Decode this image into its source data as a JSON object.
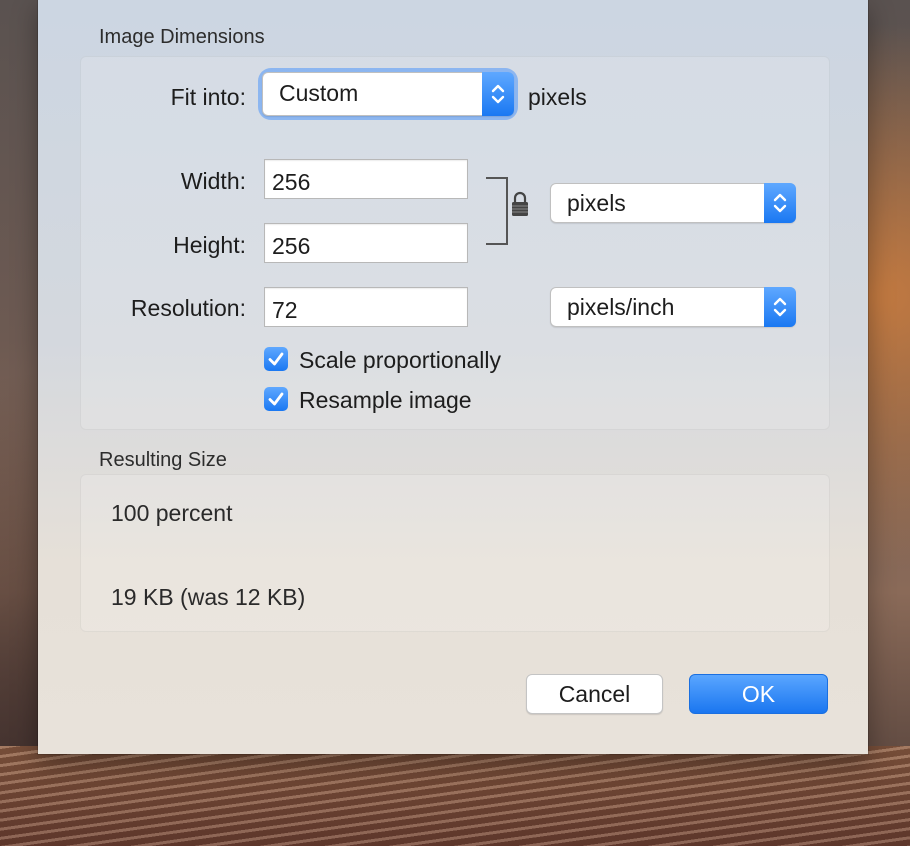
{
  "dimensions": {
    "section_title": "Image Dimensions",
    "fit_into": {
      "label": "Fit into:",
      "value": "Custom",
      "suffix": "pixels"
    },
    "width": {
      "label": "Width:",
      "value": "256"
    },
    "height": {
      "label": "Height:",
      "value": "256"
    },
    "resolution": {
      "label": "Resolution:",
      "value": "72"
    },
    "size_unit": "pixels",
    "resolution_unit": "pixels/inch",
    "scale_proportionally": {
      "label": "Scale proportionally",
      "checked": true
    },
    "resample_image": {
      "label": "Resample image",
      "checked": true
    },
    "lock_icon": "lock-icon"
  },
  "result": {
    "section_title": "Resulting Size",
    "percent": "100 percent",
    "file_size": "19 KB (was 12 KB)"
  },
  "buttons": {
    "cancel": "Cancel",
    "ok": "OK"
  },
  "colors": {
    "accent": "#1a78f2"
  }
}
